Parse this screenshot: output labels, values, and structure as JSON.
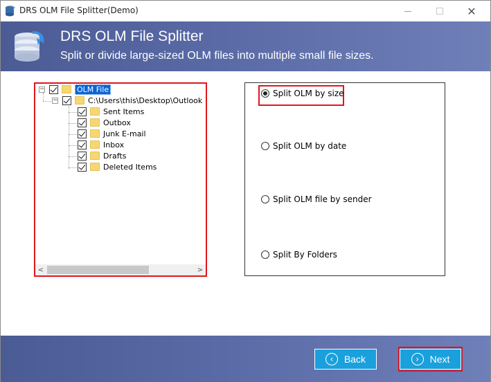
{
  "window": {
    "title": "DRS OLM File Splitter(Demo)",
    "controls": {
      "minimize": "minimize",
      "maximize": "maximize",
      "close": "✕"
    }
  },
  "banner": {
    "title": "DRS OLM File Splitter",
    "subtitle": "Split or divide large-sized OLM files into multiple small file sizes."
  },
  "tree": {
    "root": {
      "label": "OLM File",
      "expander": "−"
    },
    "path": {
      "label": "C:\\Users\\this\\Desktop\\Outlook",
      "expander": "−"
    },
    "folders": [
      {
        "label": "Sent Items"
      },
      {
        "label": "Outbox"
      },
      {
        "label": "Junk E-mail"
      },
      {
        "label": "Inbox"
      },
      {
        "label": "Drafts"
      },
      {
        "label": "Deleted Items"
      }
    ],
    "scroll_left": "<",
    "scroll_right": ">"
  },
  "options": [
    {
      "label": "Split OLM by size",
      "selected": true
    },
    {
      "label": "Split OLM by date",
      "selected": false
    },
    {
      "label": "Split OLM file by sender",
      "selected": false
    },
    {
      "label": "Split By Folders",
      "selected": false
    }
  ],
  "footer": {
    "back_label": "Back",
    "back_icon": "‹",
    "next_label": "Next",
    "next_icon": "›"
  },
  "colors": {
    "banner": "#5a6aa6",
    "button": "#1aa0dc",
    "highlight": "#e0151c",
    "selection": "#0a64d6"
  }
}
